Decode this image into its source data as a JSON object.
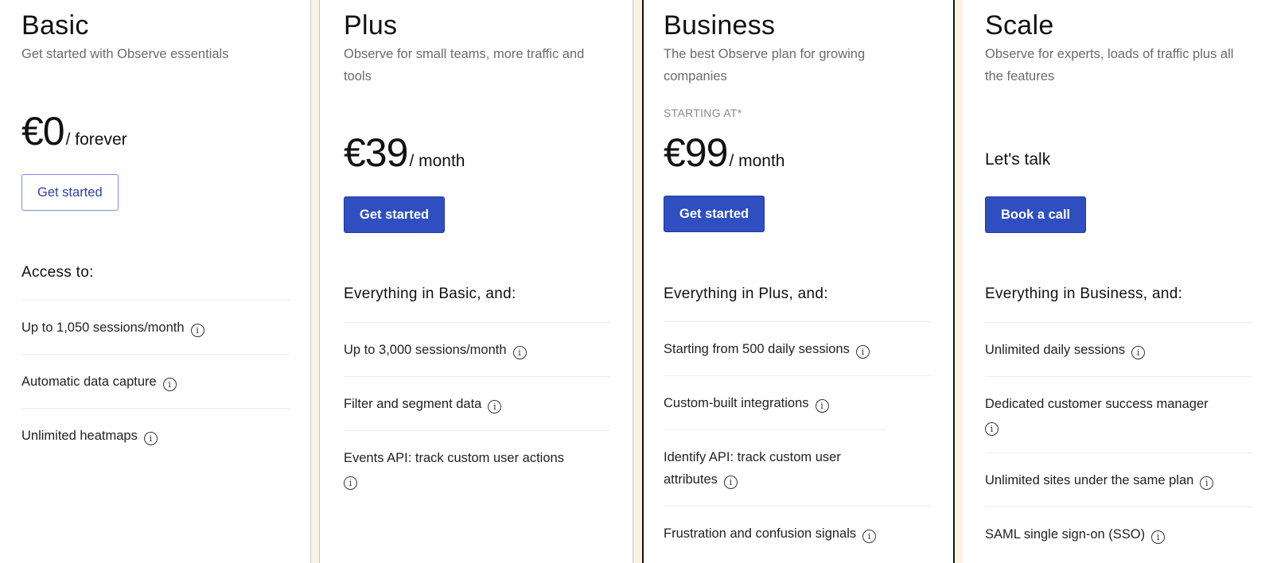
{
  "plans": [
    {
      "name": "Basic",
      "subtitle": "Get started with Observe essentials",
      "price": "€0",
      "period": "/ forever",
      "button": "Get started",
      "features_heading": "Access to:",
      "features": [
        "Up to 1,050 sessions/month",
        "Automatic data capture",
        "Unlimited heatmaps"
      ]
    },
    {
      "name": "Plus",
      "subtitle": "Observe for small teams, more traffic and tools",
      "price": "€39",
      "period": "/ month",
      "button": "Get started",
      "features_heading": "Everything in Basic, and:",
      "features": [
        "Up to 3,000 sessions/month",
        "Filter and segment data",
        "Events API: track custom user actions"
      ]
    },
    {
      "name": "Business",
      "subtitle": "The best Observe plan for growing companies",
      "starting_label": "STARTING AT*",
      "price": "€99",
      "period": "/ month",
      "button": "Get started",
      "features_heading": "Everything in Plus, and:",
      "features": [
        "Starting from 500 daily sessions",
        "Custom-built integrations",
        "Identify API: track custom user attributes",
        "Frustration and confusion signals"
      ]
    },
    {
      "name": "Scale",
      "subtitle": "Observe for experts, loads of traffic plus all the features",
      "price_text": "Let's talk",
      "button": "Book a call",
      "features_heading": "Everything in Business, and:",
      "features": [
        "Unlimited daily sessions",
        "Dedicated customer success manager",
        "Unlimited sites under the same plan",
        "SAML single sign-on (SSO)"
      ]
    }
  ],
  "info_icon": "info-circle-icon",
  "colors": {
    "accent": "#2f4fc0",
    "background": "#f8f4e3",
    "highlight_border": "#111111"
  }
}
